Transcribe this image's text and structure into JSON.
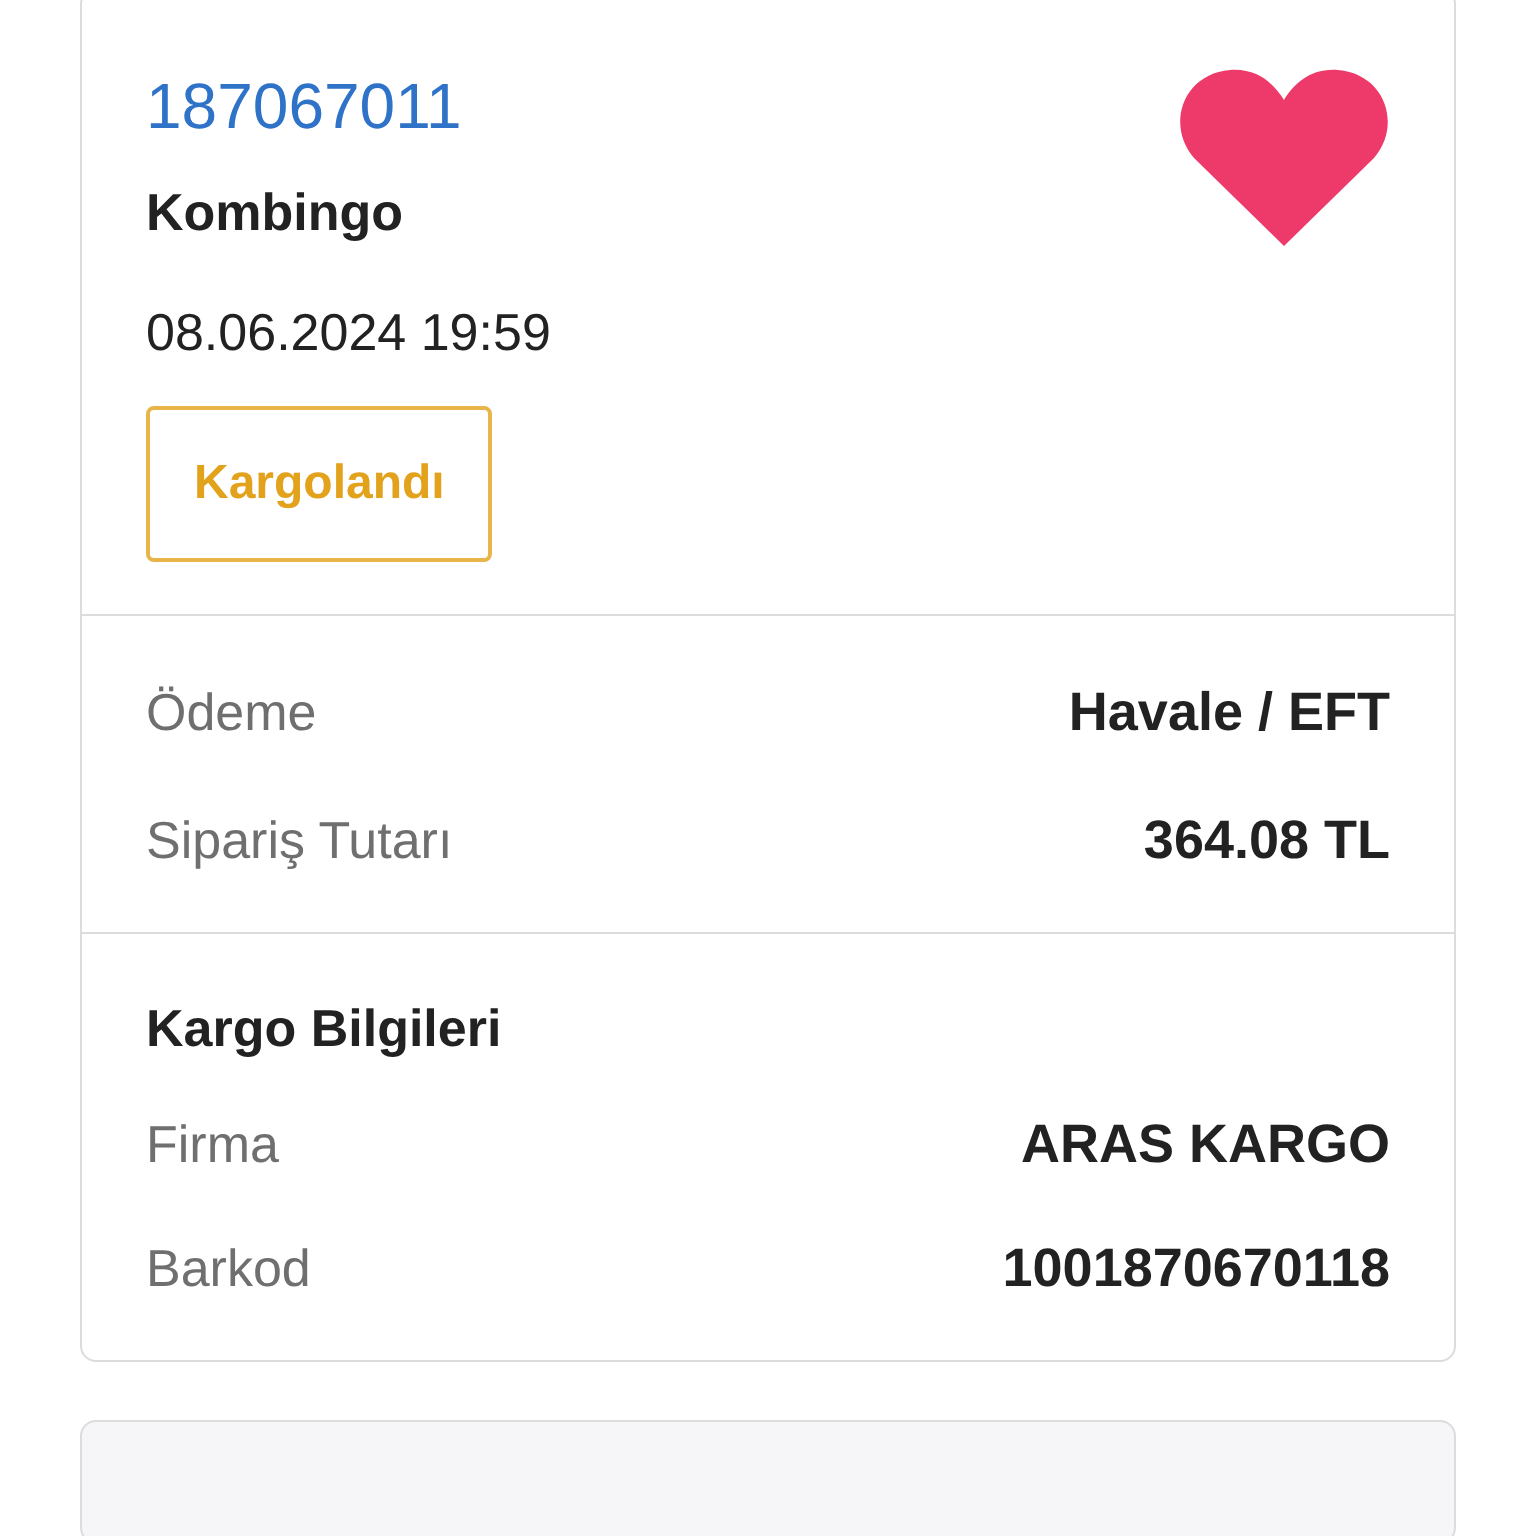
{
  "order": {
    "number": "187067011",
    "store": "Kombingo",
    "date": "08.06.2024 19:59",
    "status": "Kargolandı",
    "favorite": true
  },
  "payment": [
    {
      "label": "Ödeme",
      "value": "Havale / EFT"
    },
    {
      "label": "Sipariş Tutarı",
      "value": "364.08 TL"
    }
  ],
  "shipping": {
    "title": "Kargo Bilgileri",
    "rows": [
      {
        "label": "Firma",
        "value": "ARAS KARGO"
      },
      {
        "label": "Barkod",
        "value": "1001870670118"
      }
    ]
  }
}
